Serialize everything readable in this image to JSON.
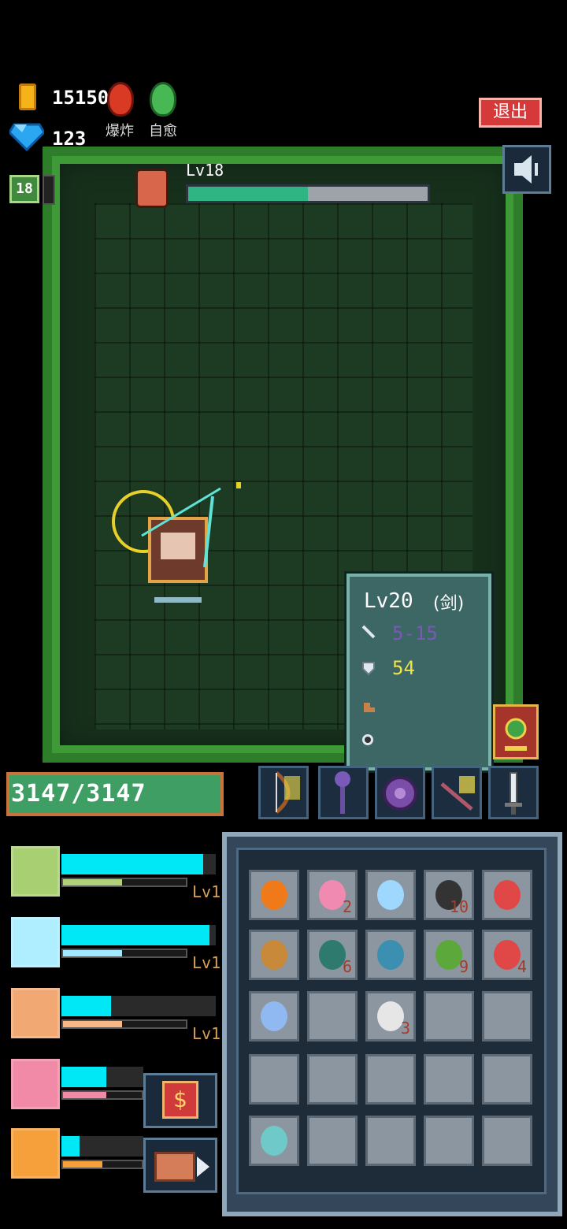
{
  "hud": {
    "gold": "15150",
    "gems": "123",
    "bomb_label": "爆炸",
    "heal_label": "自愈",
    "player_level": "18",
    "exit_label": "退出"
  },
  "boss": {
    "level_text": "Lv18",
    "hp_fraction": 0.5
  },
  "tooltip": {
    "level": "Lv20",
    "type": "(剑)",
    "attack": "5-15",
    "defense": "54"
  },
  "player": {
    "hp_text": "3147/3147"
  },
  "skills": [
    {
      "name": "bow-skill",
      "lv": "Lv1",
      "top_fill": 0.92,
      "sub_fill": 0.48,
      "sub_color": "#b0d07a",
      "icon_bg": "#a9cf73"
    },
    {
      "name": "staff-skill",
      "lv": "Lv1",
      "top_fill": 0.96,
      "sub_fill": 0.48,
      "sub_color": "#9fe8ff",
      "icon_bg": "#aeeeff"
    },
    {
      "name": "shield-skill",
      "lv": "Lv1",
      "top_fill": 0.32,
      "sub_fill": 0.48,
      "sub_color": "#f6b886",
      "icon_bg": "#f2a873"
    },
    {
      "name": "wand-skill",
      "lv": "",
      "top_fill": 0.55,
      "sub_fill": 0.55,
      "sub_color": "#f08aa6",
      "icon_bg": "#f08aa6"
    },
    {
      "name": "fire-skill",
      "lv": "",
      "top_fill": 0.22,
      "sub_fill": 0.5,
      "sub_color": "#f5a03a",
      "icon_bg": "#f5a03a"
    }
  ],
  "shop_symbol": "$",
  "inventory": {
    "counts": {
      "r0c1": "2",
      "r0c3": "10",
      "r1c1": "6",
      "r1c3": "9",
      "r1c4": "4",
      "r2c2": "3"
    }
  },
  "colors": {
    "boss_hp": "#2fb583",
    "player_hp": "#3e9e63",
    "skill_top": "#00e8f5",
    "tooltip_attack": "#7b58b8",
    "tooltip_defense": "#f1e34a"
  }
}
